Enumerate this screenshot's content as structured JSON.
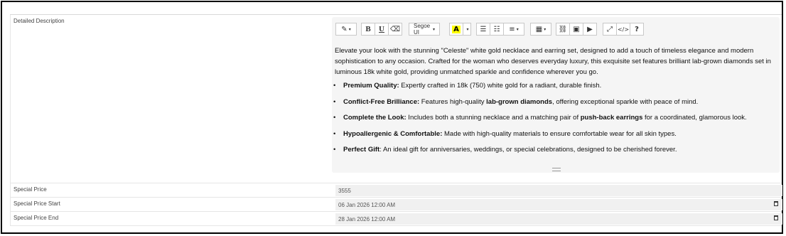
{
  "description_row": {
    "label": "Detailed Description",
    "toolbar": {
      "magic": "✎",
      "bold": "B",
      "underline": "U",
      "eraser": "⌫",
      "font": "Segoe UI",
      "highlight": "A",
      "ul": "☰",
      "ol": "☷",
      "align": "≡",
      "table": "▦",
      "link": "⛓",
      "image": "▣",
      "video": "▶",
      "fullscreen": "⤢",
      "code": "</>",
      "help": "?"
    },
    "intro": "Elevate your look with the stunning \"Celeste\" white gold necklace and earring set, designed to add a touch of timeless elegance and modern sophistication to any occasion. Crafted for the woman who deserves everyday luxury, this exquisite set features brilliant lab-grown diamonds set in luminous 18k white gold, providing unmatched sparkle and confidence wherever you go.",
    "bullets": [
      {
        "title": "Premium Quality:",
        "text": " Expertly crafted in 18k (750) white gold for a radiant, durable finish."
      },
      {
        "title": "Conflict-Free Brilliance:",
        "pre": " Features high-quality ",
        "bold2": "lab-grown diamonds",
        "post": ", offering exceptional sparkle with peace of mind."
      },
      {
        "title": "Complete the Look:",
        "pre": " Includes both a stunning necklace and a matching pair of ",
        "bold2": "push-back earrings",
        "post": " for a coordinated, glamorous look."
      },
      {
        "title": "Hypoallergenic & Comfortable:",
        "text": " Made with high-quality materials to ensure comfortable wear for all skin types."
      },
      {
        "title": "Perfect Gift",
        "text": ": An ideal gift for anniversaries, weddings, or special celebrations, designed to be cherished forever."
      }
    ]
  },
  "special_price": {
    "label": "Special Price",
    "value": "3555"
  },
  "special_price_start": {
    "label": "Special Price Start",
    "value": "06 Jan 2026 12:00 AM",
    "icon": "calendar-icon"
  },
  "special_price_end": {
    "label": "Special Price End",
    "value": "28 Jan 2026 12:00 AM",
    "icon": "calendar-icon"
  }
}
